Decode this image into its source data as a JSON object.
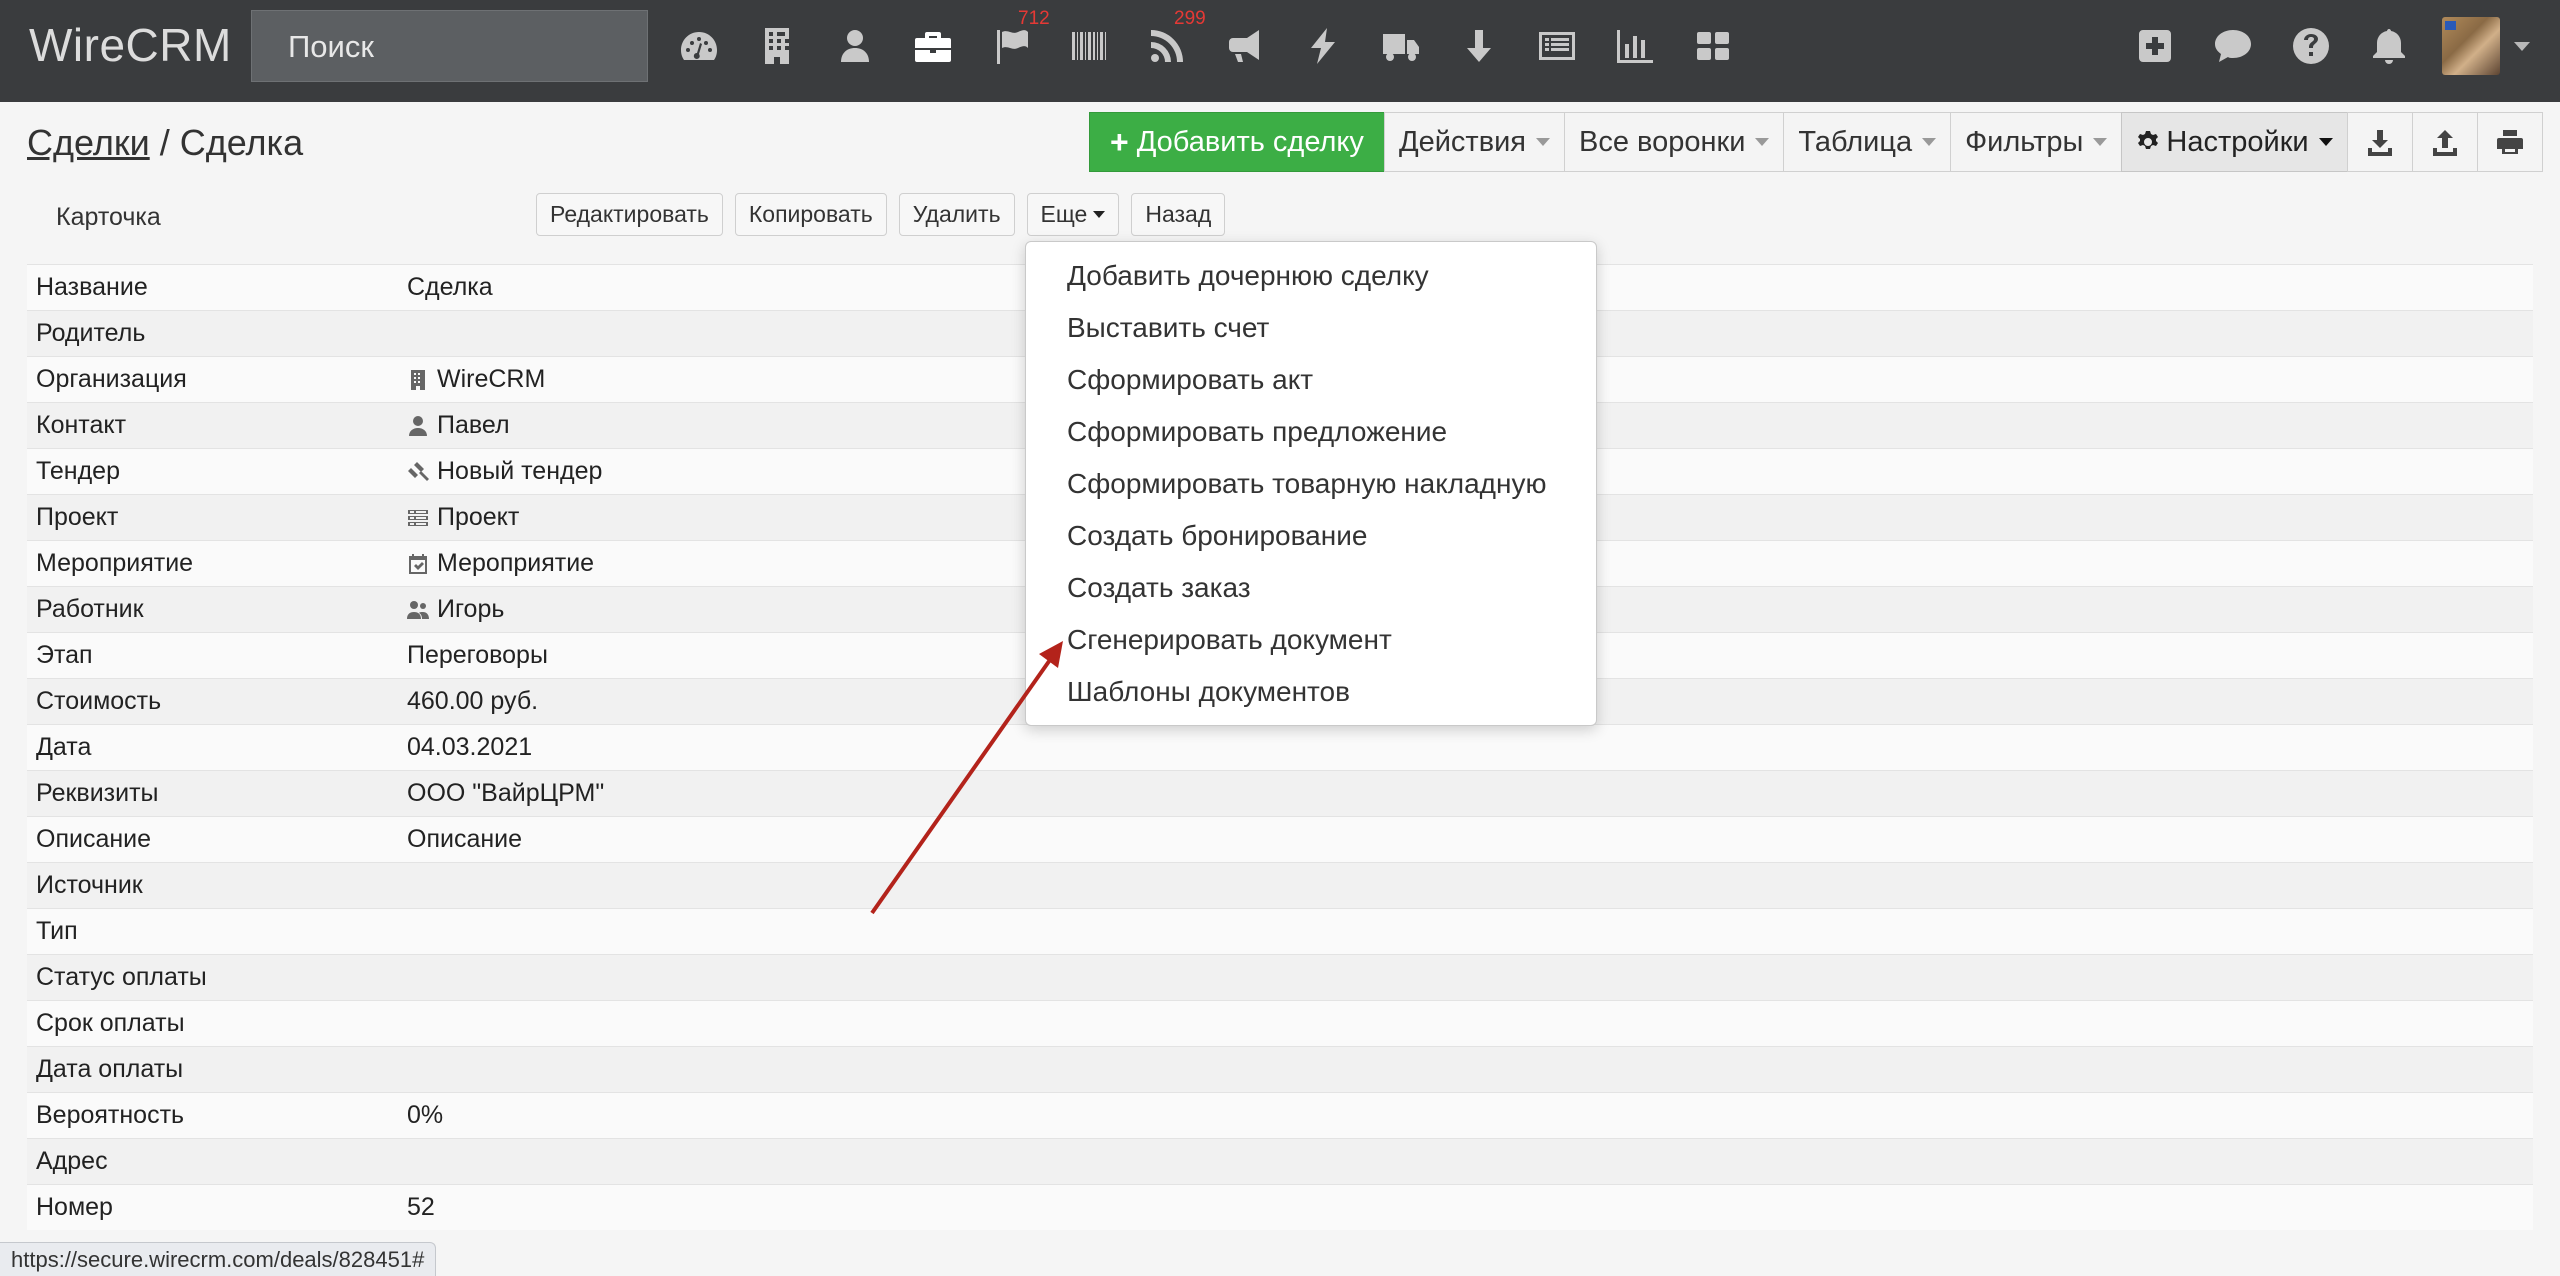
{
  "app": {
    "logo": "WireCRM"
  },
  "search": {
    "placeholder": "Поиск"
  },
  "nav": {
    "badges": {
      "flag": "712",
      "rss": "299"
    }
  },
  "breadcrumb": {
    "parent": "Сделки",
    "separator": " / ",
    "current": "Сделка"
  },
  "toolbar": {
    "add_deal": "Добавить сделку",
    "actions": "Действия",
    "all_funnels": "Все воронки",
    "table": "Таблица",
    "filters": "Фильтры",
    "settings": "Настройки"
  },
  "card": {
    "tab": "Карточка",
    "edit": "Редактировать",
    "copy": "Копировать",
    "delete": "Удалить",
    "more": "Еще",
    "back": "Назад"
  },
  "fields": [
    {
      "label": "Название",
      "value": "Сделка",
      "icon": ""
    },
    {
      "label": "Родитель",
      "value": "",
      "icon": ""
    },
    {
      "label": "Организация",
      "value": "WireCRM",
      "icon": "building-icon"
    },
    {
      "label": "Контакт",
      "value": "Павел",
      "icon": "user-icon"
    },
    {
      "label": "Тендер",
      "value": "Новый тендер",
      "icon": "gavel-icon"
    },
    {
      "label": "Проект",
      "value": "Проект",
      "icon": "tasks-icon"
    },
    {
      "label": "Мероприятие",
      "value": "Мероприятие",
      "icon": "calendar-check-icon"
    },
    {
      "label": "Работник",
      "value": "Игорь",
      "icon": "users-icon"
    },
    {
      "label": "Этап",
      "value": "Переговоры",
      "icon": ""
    },
    {
      "label": "Стоимость",
      "value": "460.00 руб.",
      "icon": ""
    },
    {
      "label": "Дата",
      "value": "04.03.2021",
      "icon": ""
    },
    {
      "label": "Реквизиты",
      "value": "ООО \"ВайрЦРМ\"",
      "icon": ""
    },
    {
      "label": "Описание",
      "value": "Описание",
      "icon": ""
    },
    {
      "label": "Источник",
      "value": "",
      "icon": ""
    },
    {
      "label": "Тип",
      "value": "",
      "icon": ""
    },
    {
      "label": "Статус оплаты",
      "value": "",
      "icon": ""
    },
    {
      "label": "Срок оплаты",
      "value": "",
      "icon": ""
    },
    {
      "label": "Дата оплаты",
      "value": "",
      "icon": ""
    },
    {
      "label": "Вероятность",
      "value": "0%",
      "icon": ""
    },
    {
      "label": "Адрес",
      "value": "",
      "icon": ""
    },
    {
      "label": "Номер",
      "value": "52",
      "icon": ""
    }
  ],
  "more_menu": {
    "items": [
      "Добавить дочернюю сделку",
      "Выставить счет",
      "Сформировать акт",
      "Сформировать предложение",
      "Сформировать товарную накладную",
      "Создать бронирование",
      "Создать заказ",
      "Сгенерировать документ",
      "Шаблоны документов"
    ]
  },
  "status_url": "https://secure.wirecrm.com/deals/828451#",
  "colors": {
    "topbar": "#3a3c3e",
    "primary_green": "#3cae45",
    "badge_red": "#e53935",
    "arrow_red": "#b3231b"
  }
}
